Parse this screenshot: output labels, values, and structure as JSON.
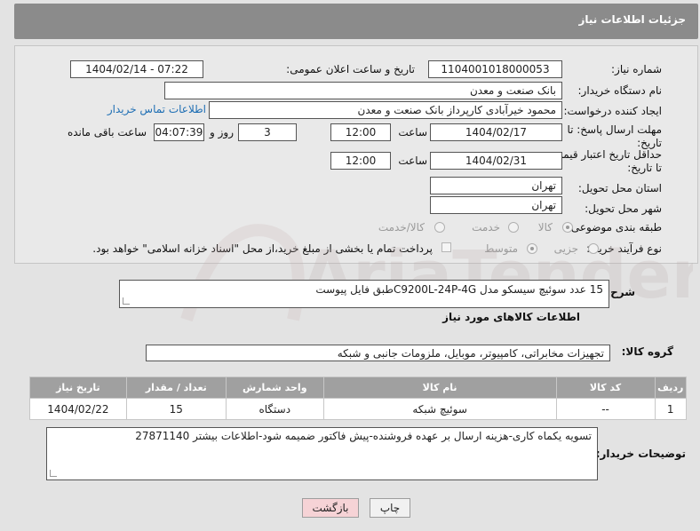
{
  "header": {
    "title": "جزئیات اطلاعات نیاز"
  },
  "form": {
    "need_number_label": "شماره نیاز:",
    "need_number": "1104001018000053",
    "announce_label": "تاریخ و ساعت اعلان عمومی:",
    "announce_value": "1404/02/14 - 07:22",
    "buyer_org_label": "نام دستگاه خریدار:",
    "buyer_org": "بانک صنعت و معدن",
    "requester_label": "ایجاد کننده درخواست:",
    "requester": "محمود خیرآبادی کارپرداز بانک صنعت و معدن",
    "contact_link": "اطلاعات تماس خریدار",
    "reply_deadline_label_1": "مهلت ارسال پاسخ: تا",
    "reply_deadline_label_2": "تاریخ:",
    "reply_date": "1404/02/17",
    "time_label": "ساعت",
    "reply_time": "12:00",
    "days_value": "3",
    "days_label": "روز و",
    "remaining_time": "04:07:39",
    "remaining_label": "ساعت باقی مانده",
    "price_validity_label_1": "حداقل تاریخ اعتبار قیمت:",
    "price_validity_label_2": "تا تاریخ:",
    "price_date": "1404/02/31",
    "price_time": "12:00",
    "province_label": "استان محل تحویل:",
    "province": "تهران",
    "city_label": "شهر محل تحویل:",
    "city": "تهران",
    "category_label": "طبقه بندی موضوعی:",
    "category_options": [
      "کالا",
      "خدمت",
      "کالا/خدمت"
    ],
    "process_label": "نوع فرآیند خرید :",
    "process_options": [
      "جزیی",
      "متوسط"
    ],
    "payment_note": "پرداخت تمام یا بخشی از مبلغ خرید،از محل \"اسناد خزانه اسلامی\" خواهد بود."
  },
  "description": {
    "label": "شرح کلی نیاز:",
    "value": "15 عدد سوئیچ سیسکو مدل C9200L-24P-4Gطبق فایل پیوست"
  },
  "goods": {
    "section_title": "اطلاعات کالاهای مورد نیاز",
    "group_label": "گروه کالا:",
    "group_value": "تجهیزات مخابراتی، کامپیوتر، موبایل، ملزومات جانبی و شبکه",
    "columns": [
      "ردیف",
      "کد کالا",
      "نام کالا",
      "واحد شمارش",
      "تعداد / مقدار",
      "تاریخ نیاز"
    ],
    "rows": [
      [
        "1",
        "--",
        "سوئیچ شبکه",
        "دستگاه",
        "15",
        "1404/02/22"
      ]
    ]
  },
  "notes": {
    "label": "توضیحات خریدار:",
    "value": "تسویه یکماه کاری-هزینه ارسال بر عهده فروشنده-پیش فاکتور ضمیمه شود-اطلاعات بیشتر 27871140"
  },
  "buttons": {
    "print": "چاپ",
    "back": "بازگشت"
  },
  "watermark": {
    "text": "AriaTender.neT"
  },
  "colors": {
    "header_bg": "#8b8b8b",
    "link": "#1f6fb4",
    "back_button_bg": "#f6d3d6"
  }
}
